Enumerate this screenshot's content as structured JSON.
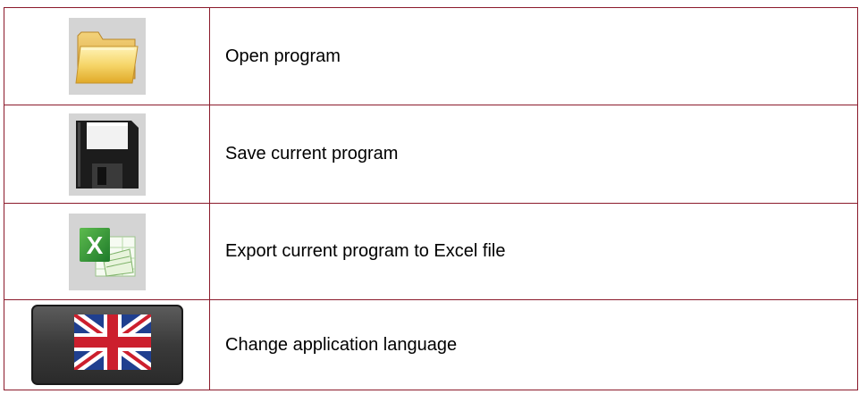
{
  "rows": [
    {
      "icon": "folder-icon",
      "label": "Open program"
    },
    {
      "icon": "floppy-disk-icon",
      "label": "Save current program"
    },
    {
      "icon": "excel-icon",
      "label": "Export current program to Excel file"
    },
    {
      "icon": "uk-flag-icon",
      "label": "Change application language"
    }
  ],
  "colors": {
    "border": "#8b1a2b",
    "icon_background": "#d4d4d4"
  }
}
